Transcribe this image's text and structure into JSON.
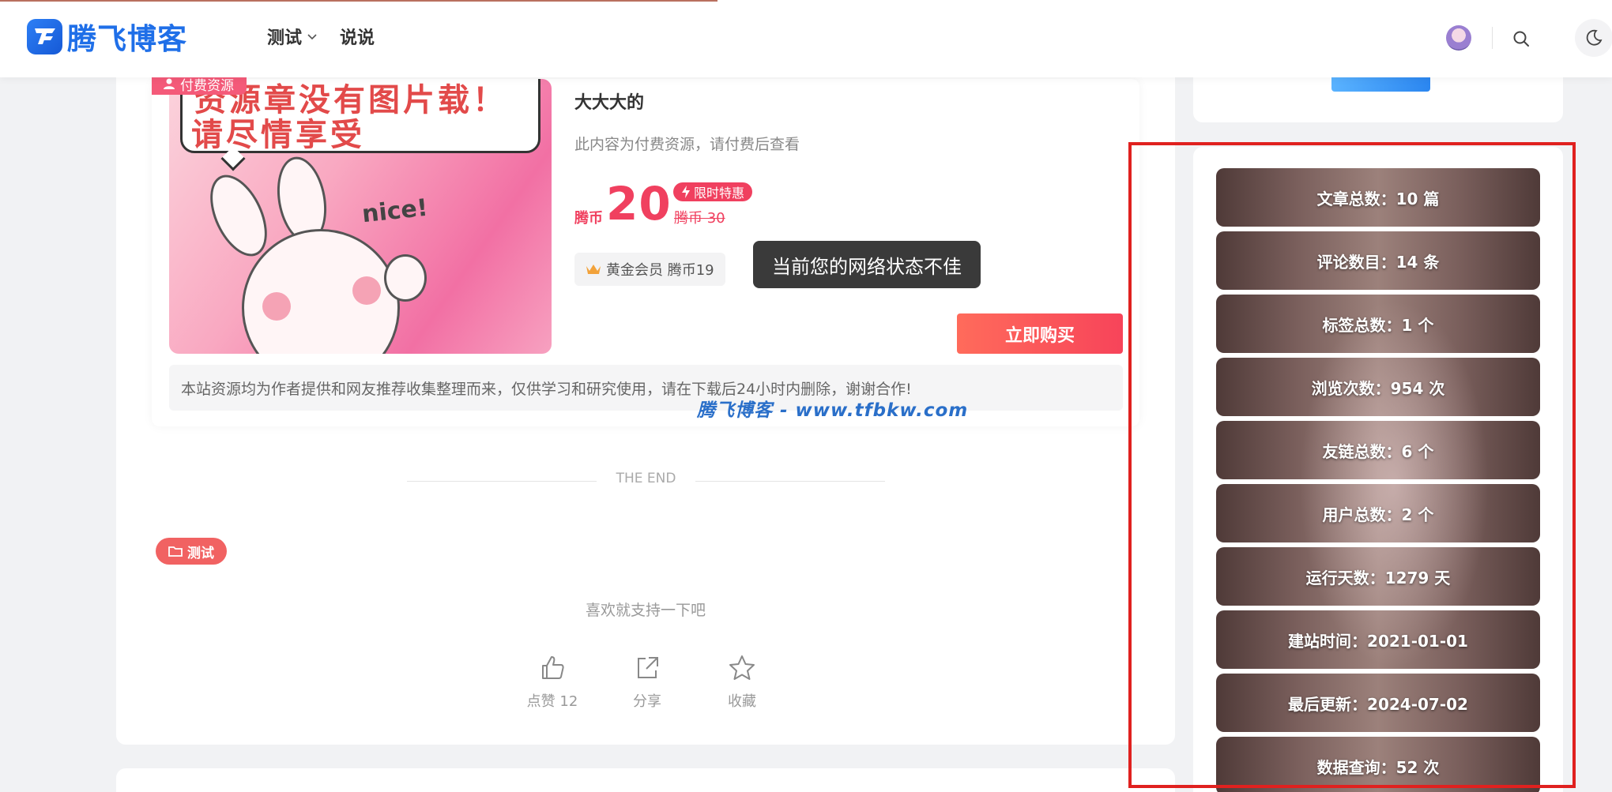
{
  "header": {
    "logo_text": "腾飞博客",
    "nav": [
      {
        "label": "测试",
        "has_dropdown": true
      },
      {
        "label": "说说",
        "has_dropdown": false
      }
    ],
    "icons": [
      "avatar",
      "search-icon",
      "moon-icon"
    ]
  },
  "product": {
    "badge": "付费资源",
    "thumbnail_text": [
      "资源章没有图片载！",
      "请尽情享受"
    ],
    "thumbnail_caption": "nice!",
    "title": "大大大的",
    "description": "此内容为付费资源，请付费后查看",
    "price_unit": "腾币",
    "price": "20",
    "sale_label": "限时特惠",
    "original_price": "腾币 30",
    "vip_label": "黄金会员 腾币19",
    "buy_button": "立即购买",
    "notice": "本站资源均为作者提供和网友推荐收集整理而来，仅供学习和研究使用，请在下载后24小时内删除，谢谢合作!"
  },
  "toast": "当前您的网络状态不佳",
  "watermark": "腾飞博客 - www.tfbkw.com",
  "article": {
    "end_text": "THE END",
    "tag": "测试",
    "support_text": "喜欢就支持一下吧",
    "actions": [
      {
        "label": "点赞 12",
        "icon": "thumbs-up-icon"
      },
      {
        "label": "分享",
        "icon": "share-icon"
      },
      {
        "label": "收藏",
        "icon": "star-icon"
      }
    ]
  },
  "sidebar": {
    "stats": [
      "文章总数：10 篇",
      "评论数目：14 条",
      "标签总数：1 个",
      "浏览次数：954 次",
      "友链总数：6 个",
      "用户总数：2 个",
      "运行天数：1279 天",
      "建站时间：2021-01-01",
      "最后更新：2024-07-02",
      "数据查询：52 次"
    ]
  },
  "colors": {
    "accent": "#f0405f",
    "brand_blue": "#1f6fe8",
    "highlight": "#e0211f"
  }
}
